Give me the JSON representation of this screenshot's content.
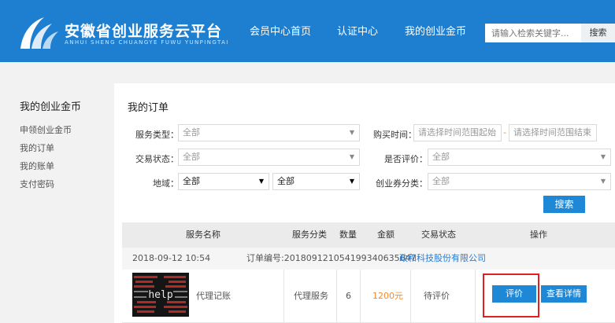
{
  "header": {
    "brand_title": "安徽省创业服务云平台",
    "brand_subtitle": "ANHUI SHENG CHUANGYE FUWU YUNPINGTAI",
    "nav": [
      "会员中心首页",
      "认证中心",
      "我的创业金币"
    ],
    "search_placeholder": "请输入检索关键字...",
    "search_button": "搜索"
  },
  "sidebar": {
    "title": "我的创业金币",
    "items": [
      "申领创业金币",
      "我的订单",
      "我的账单",
      "支付密码"
    ]
  },
  "main": {
    "title": "我的订单",
    "filters": {
      "service_type_label": "服务类型：",
      "service_type_value": "全部",
      "buy_time_label": "购买时间：",
      "buy_time_start": "请选择时间范围起始",
      "buy_time_sep": "-",
      "buy_time_end": "请选择时间范围结束",
      "trade_status_label": "交易状态：",
      "trade_status_value": "全部",
      "evaluated_label": "是否评价：",
      "evaluated_value": "全部",
      "region_label": "地域：",
      "region_value1": "全部",
      "region_value2": "全部",
      "voucher_label": "创业券分类：",
      "voucher_value": "全部",
      "search_button": "搜索"
    },
    "table": {
      "headers": [
        "服务名称",
        "服务分类",
        "数量",
        "金额",
        "交易状态",
        "操作"
      ],
      "order": {
        "date": "2018-09-12 10:54",
        "number": "订单编号:201809121054199340635647",
        "company": "政和科技股份有限公司"
      },
      "row": {
        "thumb_text": "help",
        "name": "代理记账",
        "category": "代理服务",
        "qty": "6",
        "amount": "1200元",
        "status": "待评价",
        "btn_eval": "评价",
        "btn_detail": "查看详情"
      }
    }
  },
  "colors": {
    "brand": "#1e7fd1",
    "button": "#1e88d6",
    "price": "#f08a2e",
    "highlight": "#e02020"
  }
}
